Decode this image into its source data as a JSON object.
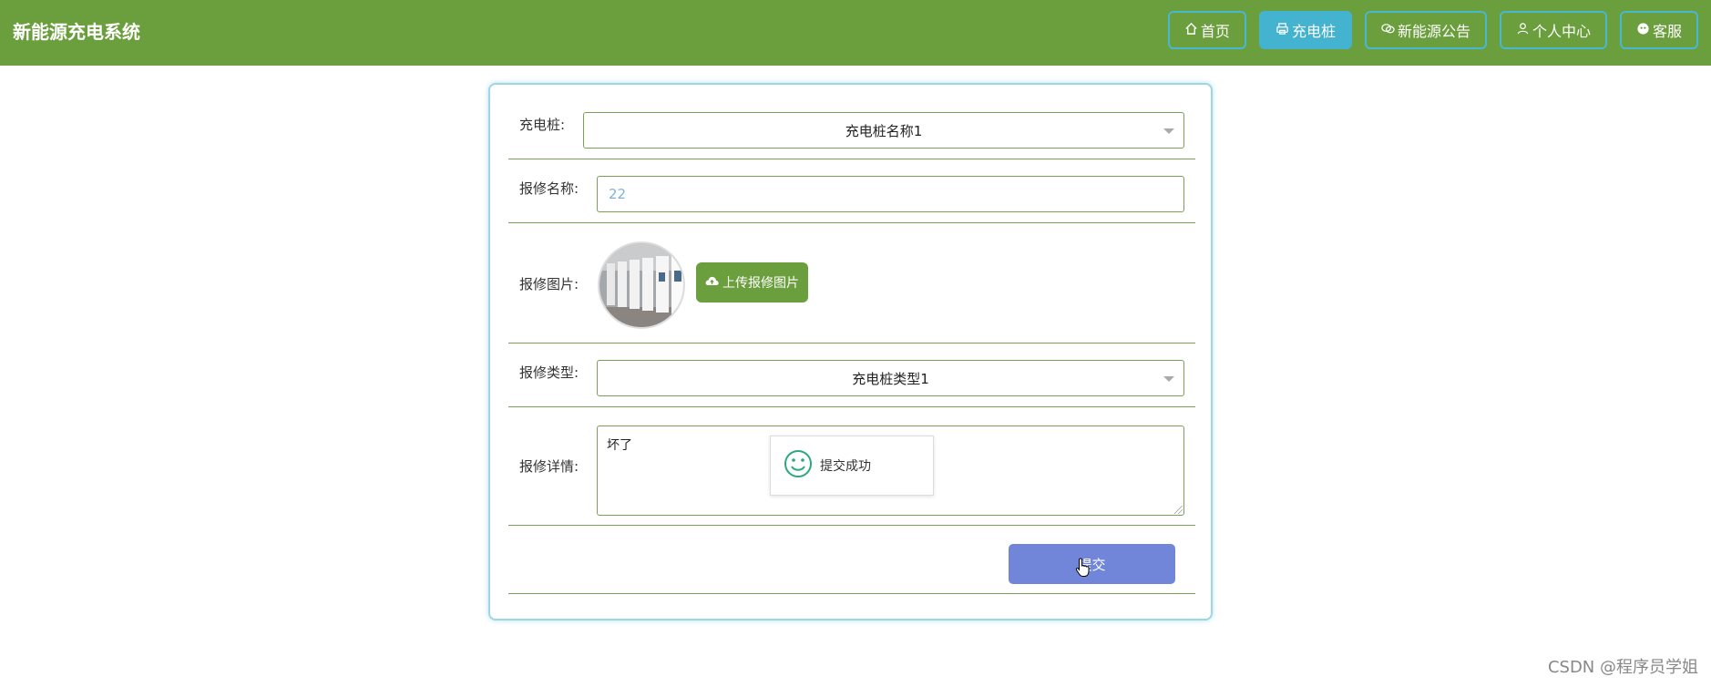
{
  "header": {
    "title": "新能源充电系统",
    "nav": [
      {
        "label": "首页",
        "icon": "home-icon"
      },
      {
        "label": "充电桩",
        "icon": "printer-icon",
        "active": true
      },
      {
        "label": "新能源公告",
        "icon": "chat-bubbles-icon"
      },
      {
        "label": "个人中心",
        "icon": "user-icon"
      },
      {
        "label": "客服",
        "icon": "service-icon"
      }
    ]
  },
  "form": {
    "charger_label": "充电桩:",
    "charger_value": "充电桩名称1",
    "name_label": "报修名称:",
    "name_value": "22",
    "image_label": "报修图片:",
    "upload_label": "上传报修图片",
    "type_label": "报修类型:",
    "type_value": "充电桩类型1",
    "detail_label": "报修详情:",
    "detail_value": "坏了",
    "submit_label": "提交"
  },
  "toast": {
    "message": "提交成功",
    "icon": "smile-icon"
  },
  "watermark": "CSDN @程序员学姐",
  "colors": {
    "header": "#6b9e3c",
    "nav_active": "#44b3d0",
    "submit": "#7186d9",
    "toast_icon": "#2aa87e"
  }
}
